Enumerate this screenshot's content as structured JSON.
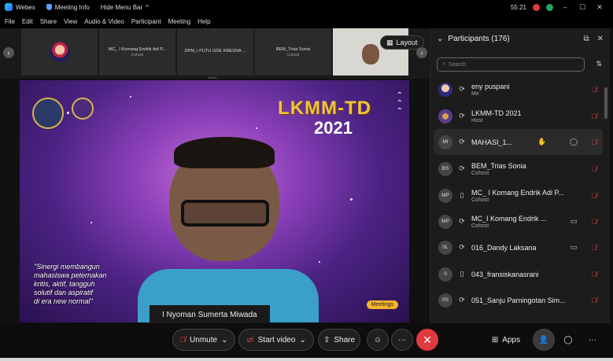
{
  "titlebar": {
    "app_name": "Webex",
    "meeting_info": "Meeting Info",
    "hide_menu_bar": "Hide Menu Bar",
    "hide_menu_chevron": "^",
    "time": "55:21",
    "win_min": "–",
    "win_max": "☐",
    "win_close": "✕"
  },
  "menubar": {
    "items": [
      "File",
      "Edit",
      "Share",
      "View",
      "Audio & Video",
      "Participant",
      "Meeting",
      "Help"
    ]
  },
  "strip": {
    "prev": "‹",
    "next": "›",
    "thumbs": [
      {
        "name": "MC_ I Komang Endrik Adi P...",
        "role": "Cohost"
      },
      {
        "name": "DPM_I PUTU GDE KRESNA ...",
        "role": ""
      },
      {
        "name": "BEM_Trias Sonia",
        "role": "Cohost"
      }
    ],
    "layout_label": "Layout",
    "strip_handle": "===="
  },
  "video": {
    "title": "LKMM-TD",
    "year": "2021",
    "quote_lines": [
      "\"Sinergi membangun",
      "mahasiswa peternakan",
      "kritis, aktif, tangguh",
      "solutif dan aspiratif",
      "di era new normal\""
    ],
    "badge": "Meetings",
    "speaker_name": "I Nyoman Sumerta Miwada"
  },
  "panel": {
    "title": "Participants (176)",
    "search_placeholder": "Search",
    "popout_icon": "⧉",
    "close_icon": "✕",
    "sort_icon": "⇅",
    "participants": [
      {
        "initials": "",
        "name": "eny puspani",
        "role": "Me",
        "audio": "⟳",
        "mic_muted": true
      },
      {
        "initials": "",
        "name": "LKMM-TD 2021",
        "role": "Host",
        "audio": "⟳",
        "mic_muted": true
      },
      {
        "initials": "MI",
        "name": "MAHASI_1...",
        "role": "",
        "audio": "⟳",
        "mic_muted": true,
        "hand": "✋",
        "chat": true
      },
      {
        "initials": "BS",
        "name": "BEM_Trias Sonia",
        "role": "Cohost",
        "audio": "⟳",
        "mic_muted": true
      },
      {
        "initials": "MP",
        "name": "MC_ I Komang Endrik Adi P...",
        "role": "Cohost",
        "audio": "▯",
        "mic_muted": true
      },
      {
        "initials": "MP",
        "name": "MC_I Komang Endrik ...",
        "role": "Cohost",
        "audio": "⟳",
        "mic_muted": false,
        "video": true
      },
      {
        "initials": "0L",
        "name": "016_Dandy Laksana",
        "role": "",
        "audio": "⟳",
        "mic_muted": false,
        "video": true
      },
      {
        "initials": "0",
        "name": "043_fransiskanasrani",
        "role": "",
        "audio": "▯",
        "mic_muted": true
      },
      {
        "initials": "0S",
        "name": "051_Sanju Parningotan Sim...",
        "role": "",
        "audio": "⟳",
        "mic_muted": true
      }
    ]
  },
  "controls": {
    "unmute_label": "Unmute",
    "start_video_label": "Start video",
    "share_label": "Share",
    "apps_label": "Apps",
    "chevron": "⌄",
    "more": "···",
    "end": "✕",
    "accent_red": "#e0393e"
  }
}
